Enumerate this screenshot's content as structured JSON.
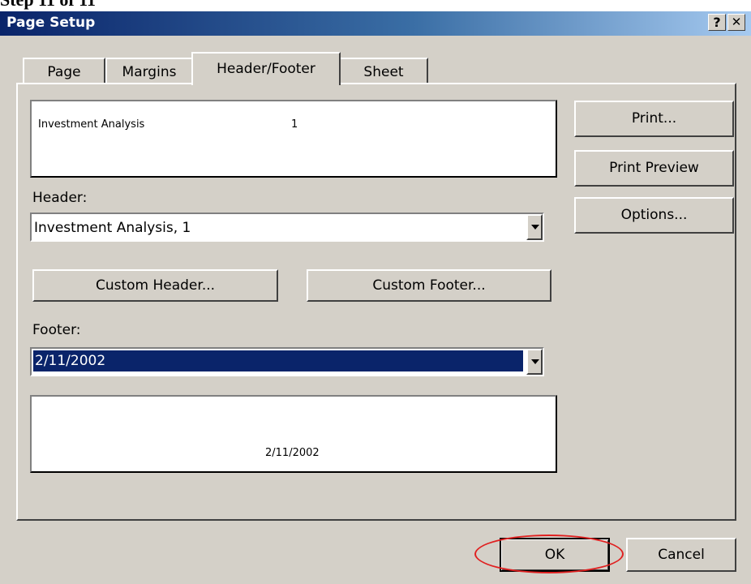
{
  "caption": "Step 11 of 11",
  "window": {
    "title": "Page Setup",
    "help_label": "?",
    "close_label": "✕"
  },
  "tabs": [
    {
      "label": "Page"
    },
    {
      "label": "Margins"
    },
    {
      "label": "Header/Footer",
      "active": true
    },
    {
      "label": "Sheet"
    }
  ],
  "header_preview": {
    "left": "Investment Analysis",
    "center": "1"
  },
  "header": {
    "label": "Header:",
    "value": "Investment Analysis, 1"
  },
  "buttons": {
    "custom_header": "Custom Header...",
    "custom_footer": "Custom Footer...",
    "print": "Print...",
    "print_preview": "Print Preview",
    "options": "Options...",
    "ok": "OK",
    "cancel": "Cancel"
  },
  "footer": {
    "label": "Footer:",
    "value": "2/11/2002"
  },
  "footer_preview": {
    "center": "2/11/2002"
  },
  "colors": {
    "title_bar": "#0a246a",
    "dialog_bg": "#d4d0c8",
    "selection": "#0a246a",
    "annotation": "#e02020"
  },
  "icons": [
    "help-icon",
    "close-icon",
    "dropdown-arrow-icon"
  ]
}
